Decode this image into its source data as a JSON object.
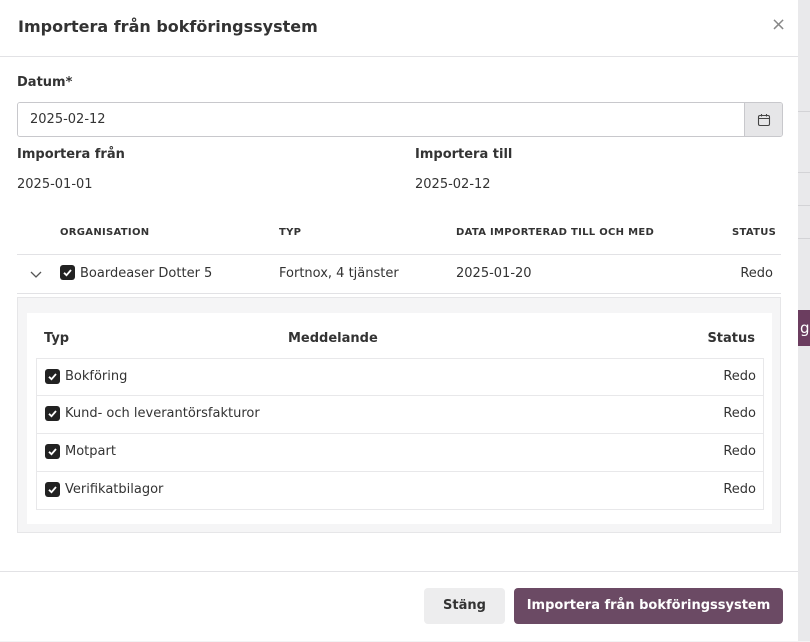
{
  "background": {
    "accent_color": "#6b3d5f",
    "sliver_text": "g"
  },
  "modal": {
    "title": "Importera från bokföringssystem",
    "close_label": "×"
  },
  "form": {
    "date_label": "Datum*",
    "date_value": "2025-02-12",
    "import_from_label": "Importera från",
    "import_from_value": "2025-01-01",
    "import_to_label": "Importera till",
    "import_to_value": "2025-02-12"
  },
  "table": {
    "headers": {
      "organisation": "ORGANISATION",
      "type": "TYP",
      "imported_until": "DATA IMPORTERAD TILL OCH MED",
      "status": "STATUS"
    },
    "rows": [
      {
        "organisation": "Boardeaser Dotter 5",
        "type": "Fortnox, 4 tjänster",
        "imported_until": "2025-01-20",
        "status": "Redo",
        "checked": true
      }
    ]
  },
  "details": {
    "headers": {
      "type": "Typ",
      "message": "Meddelande",
      "status": "Status"
    },
    "items": [
      {
        "name": "Bokföring",
        "message": "",
        "status": "Redo",
        "checked": true
      },
      {
        "name": "Kund- och leverantörsfakturor",
        "message": "",
        "status": "Redo",
        "checked": true
      },
      {
        "name": "Motpart",
        "message": "",
        "status": "Redo",
        "checked": true
      },
      {
        "name": "Verifikatbilagor",
        "message": "",
        "status": "Redo",
        "checked": true
      }
    ]
  },
  "footer": {
    "close_button": "Stäng",
    "primary_button": "Importera från bokföringssystem",
    "primary_color": "#6b4a64"
  },
  "icons": {
    "close": "close-icon",
    "calendar": "calendar-icon",
    "chevron": "chevron-down-icon",
    "check": "checkmark-icon"
  }
}
